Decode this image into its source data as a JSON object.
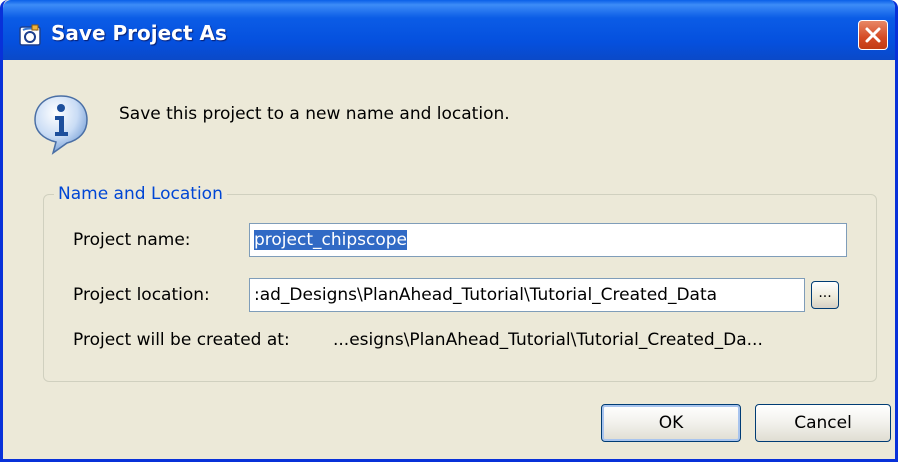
{
  "window": {
    "title": "Save Project As",
    "app_icon": "planahead-app-icon",
    "close_icon": "close-icon"
  },
  "header": {
    "icon": "info-icon",
    "message": "Save this project to a new name and location."
  },
  "group": {
    "legend": "Name and Location",
    "project_name_label": "Project name:",
    "project_name_value": "project_chipscope",
    "project_location_label": "Project location:",
    "project_location_value": ":ad_Designs\\PlanAhead_Tutorial\\Tutorial_Created_Data",
    "browse_label": "...",
    "created_at_label": "Project will be created at:",
    "created_at_value": "...esigns\\PlanAhead_Tutorial\\Tutorial_Created_Da..."
  },
  "buttons": {
    "ok": "OK",
    "cancel": "Cancel"
  },
  "colors": {
    "titlebar": "#0550de",
    "window_bg": "#ece9d8",
    "legend_text": "#0046d5",
    "selection": "#316ac5",
    "close_button": "#d44a24"
  }
}
